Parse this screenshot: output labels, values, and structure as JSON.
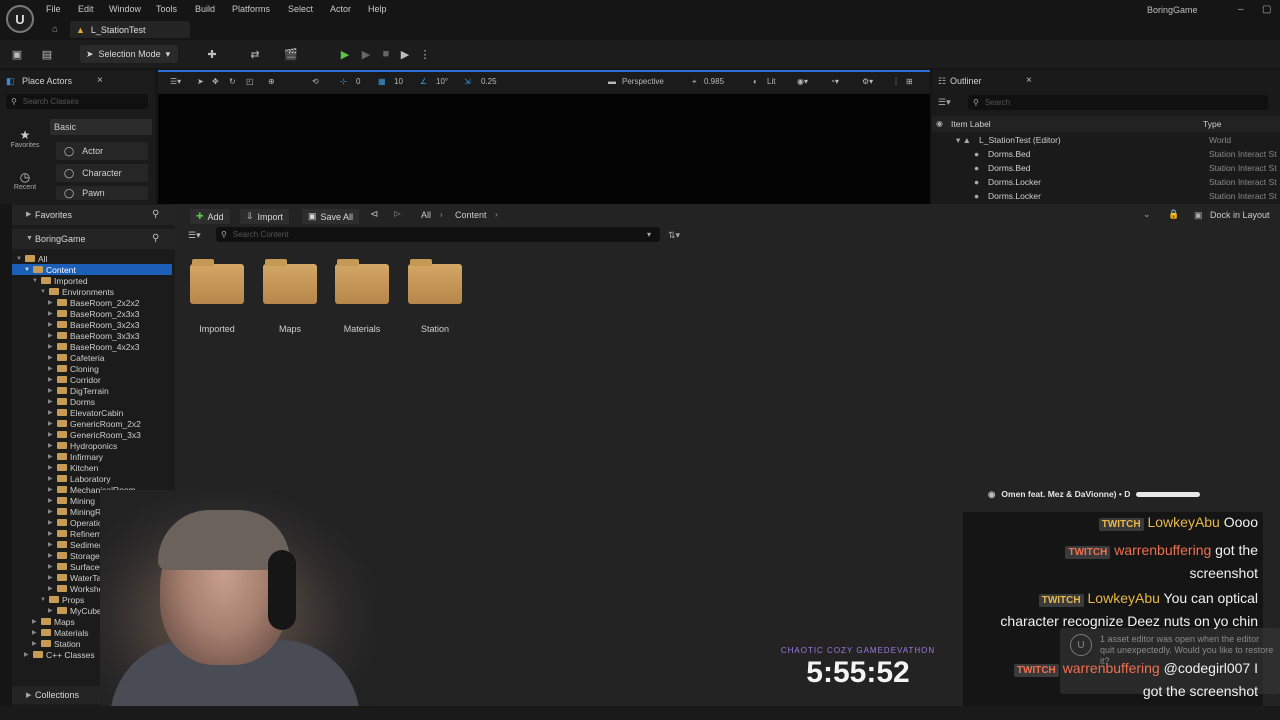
{
  "menu": {
    "items": [
      "File",
      "Edit",
      "Window",
      "Tools",
      "Build",
      "Platforms",
      "Select",
      "Actor",
      "Help"
    ],
    "brand": "BoringGame",
    "logo": "U"
  },
  "level_tab": {
    "name": "L_StationTest"
  },
  "toolbar": {
    "selection_mode": "Selection Mode"
  },
  "place_actors": {
    "title": "Place Actors",
    "search_placeholder": "Search Classes",
    "categories": [
      {
        "icon": "star-icon",
        "label": "Favorites"
      },
      {
        "icon": "clock-icon",
        "label": "Recent"
      }
    ],
    "section": "Basic",
    "actors": [
      "Actor",
      "Character",
      "Pawn"
    ]
  },
  "viewport": {
    "snap_angle": "0",
    "grid_snap": "10",
    "rotation_snap": "10°",
    "scale_snap": "0.25",
    "view_mode": "Perspective",
    "fov": "0.985",
    "lighting": "Lit"
  },
  "outliner": {
    "title": "Outliner",
    "search_placeholder": "Search",
    "col_label": "Item Label",
    "col_type": "Type",
    "rows": [
      {
        "label": "L_StationTest (Editor)",
        "type": "World"
      },
      {
        "label": "Dorms.Bed",
        "type": "Station Interact St"
      },
      {
        "label": "Dorms.Bed",
        "type": "Station Interact St"
      },
      {
        "label": "Dorms.Locker",
        "type": "Station Interact St"
      },
      {
        "label": "Dorms.Locker",
        "type": "Station Interact St"
      }
    ]
  },
  "content_browser": {
    "favorites": "Favorites",
    "project": "BoringGame",
    "add": "Add",
    "import": "Import",
    "save_all": "Save All",
    "path": [
      "All",
      "Content"
    ],
    "search_placeholder": "Search Content",
    "dock": "Dock in Layout",
    "collections": "Collections",
    "tree": {
      "all": "All",
      "content": "Content",
      "imported": "Imported",
      "environments": "Environments",
      "env_items": [
        "BaseRoom_2x2x2",
        "BaseRoom_2x3x3",
        "BaseRoom_3x2x3",
        "BaseRoom_3x3x3",
        "BaseRoom_4x2x3",
        "Cafeteria",
        "Cloning",
        "Corridor",
        "DigTerrain",
        "Dorms",
        "ElevatorCabin",
        "GenericRoom_2x2",
        "GenericRoom_3x3",
        "Hydroponics",
        "Infirmary",
        "Kitchen",
        "Laboratory",
        "MechanicalRoom",
        "Mining",
        "MiningRoom",
        "Operations",
        "Refinement",
        "SedimentFace",
        "Storage",
        "SurfaceCity",
        "WaterTanks",
        "Workshop"
      ],
      "props": "Props",
      "mycube": "MyCube",
      "tail": [
        "Maps",
        "Materials",
        "Station",
        "C++ Classes"
      ]
    },
    "folders": [
      "Imported",
      "Maps",
      "Materials",
      "Station"
    ]
  },
  "stream": {
    "now_playing": "Omen feat. Mez & DaVionne) • D",
    "chat": [
      {
        "badge": "TWITCH",
        "user": "LowkeyAbu",
        "color": "#e8b84a",
        "text": "Oooo"
      },
      {
        "badge": "TWITCH",
        "user": "warrenbuffering",
        "color": "#f07050",
        "text": "got the screenshot"
      },
      {
        "badge": "TWITCH",
        "user": "LowkeyAbu",
        "color": "#e8b84a",
        "text": "You can optical character recognize Deez nuts on yo chin"
      },
      {
        "badge": "TWITCH",
        "user": "warrenbuffering",
        "color": "#f07050",
        "text": "@codegirl007 I got the screenshot"
      }
    ],
    "event_label": "CHAOTIC COZY GAMEDEVATHON",
    "timer": "5:55:52",
    "toast": "1 asset editor was open when the editor quit unexpectedly. Would you like to restore it?"
  }
}
